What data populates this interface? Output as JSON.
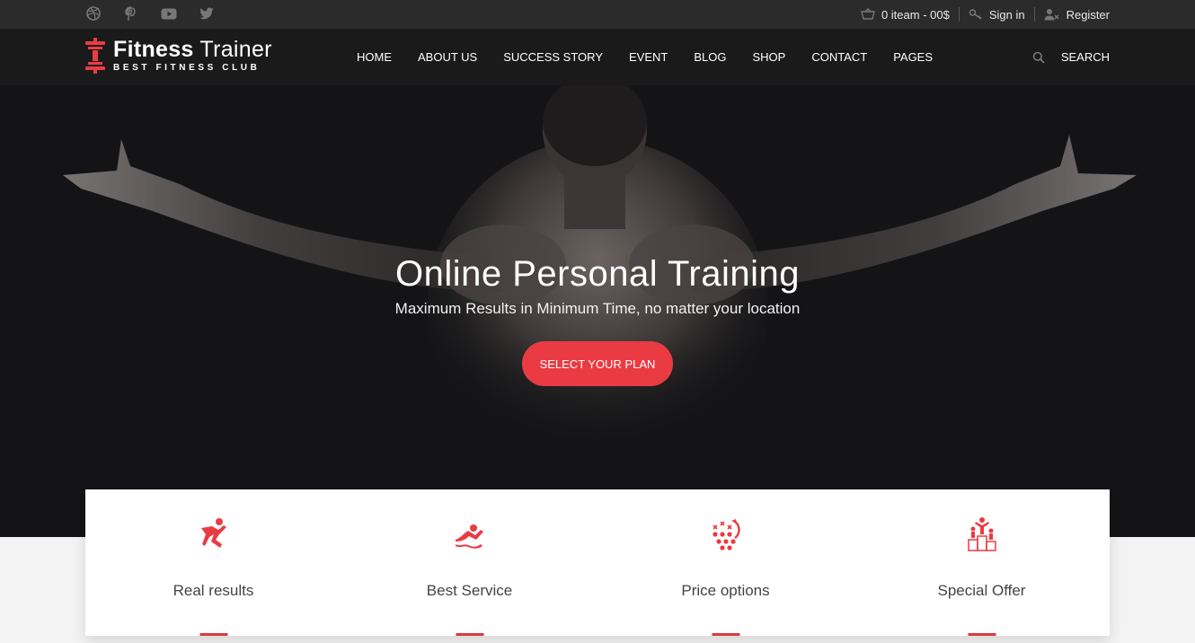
{
  "colors": {
    "accent": "#ea3b43",
    "topbar_bg": "#2b2b2b",
    "header_bg": "#1a1a1a",
    "hero_bg": "#141416"
  },
  "topbar": {
    "social": [
      {
        "name": "dribbble-icon"
      },
      {
        "name": "pinterest-icon"
      },
      {
        "name": "youtube-icon"
      },
      {
        "name": "twitter-icon"
      }
    ],
    "cart_label": "0 iteam - 00$",
    "signin_label": "Sign in",
    "register_label": "Register"
  },
  "header": {
    "logo_bold": "Fitness",
    "logo_light": "Trainer",
    "logo_sub": "BEST FITNESS CLUB",
    "nav": [
      "HOME",
      "ABOUT US",
      "SUCCESS STORY",
      "EVENT",
      "BLOG",
      "SHOP",
      "CONTACT",
      "PAGES"
    ],
    "search_label": "SEARCH"
  },
  "hero": {
    "title": "Online Personal Training",
    "subtitle": "Maximum Results in Minimum Time, no matter your location",
    "button_label": "SELECT YOUR PLAN"
  },
  "features": [
    {
      "label": "Real results",
      "icon": "runner-icon"
    },
    {
      "label": "Best Service",
      "icon": "swimmer-icon"
    },
    {
      "label": "Price options",
      "icon": "strategy-icon"
    },
    {
      "label": "Special Offer",
      "icon": "podium-icon"
    }
  ]
}
